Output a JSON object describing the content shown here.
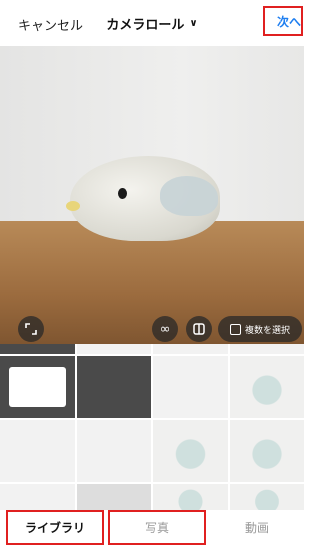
{
  "header": {
    "cancel": "キャンセル",
    "title": "カメラロール",
    "title_chevron": "∨",
    "next": "次へ"
  },
  "preview": {
    "expand_icon": "expand-icon",
    "boomerang_icon": "∞",
    "layout_icon": "layout-icon",
    "multi_select": "複数を選択"
  },
  "tabs": [
    {
      "label": "ライブラリ"
    },
    {
      "label": "写真"
    },
    {
      "label": "動画"
    }
  ],
  "colors": {
    "accent": "#1e7ef0",
    "highlight": "#e02020"
  }
}
